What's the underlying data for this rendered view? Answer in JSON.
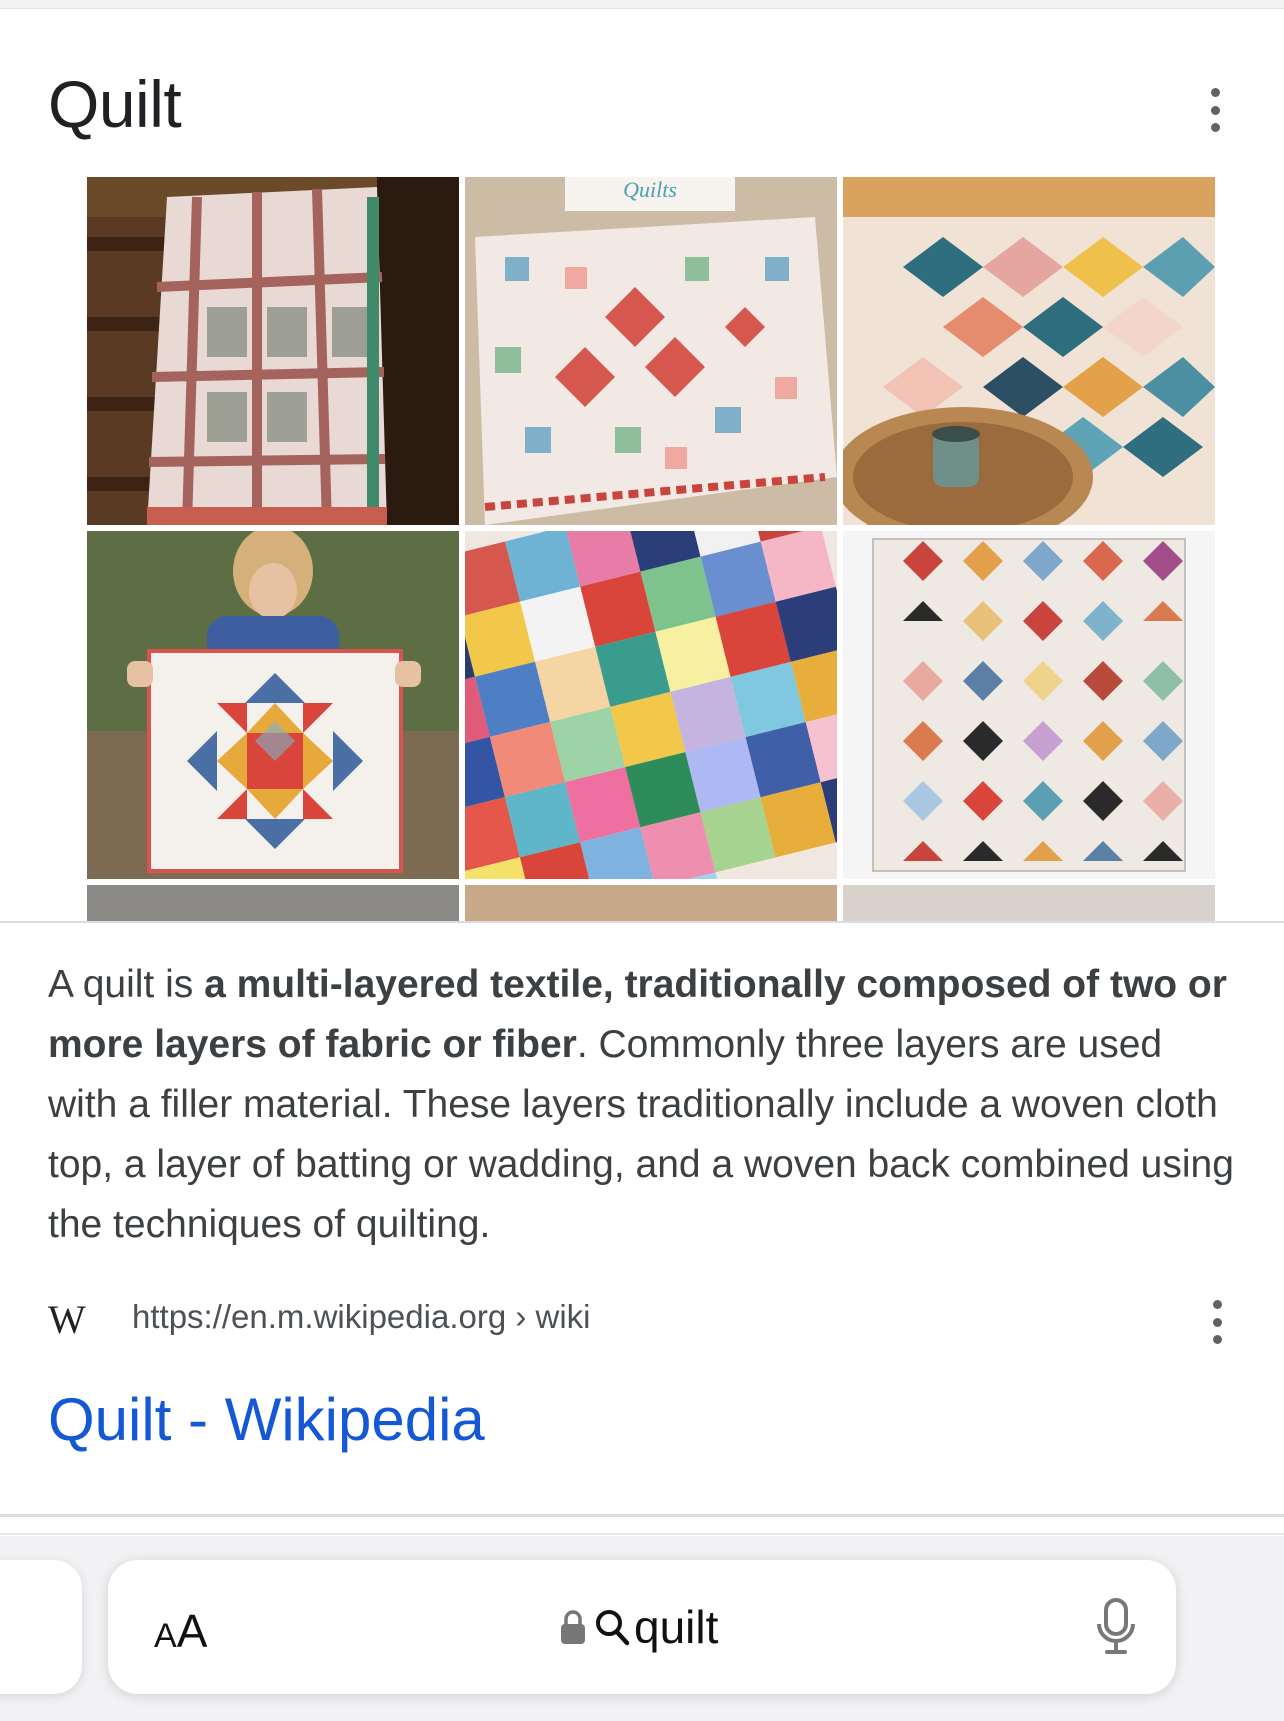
{
  "panel": {
    "title": "Quilt",
    "menu_icon": "more-vert-icon"
  },
  "image_grid": {
    "images": [
      {
        "name": "quilt-image-1",
        "description_icon": "image"
      },
      {
        "name": "quilt-image-2",
        "description_icon": "image"
      },
      {
        "name": "quilt-image-3",
        "description_icon": "image"
      },
      {
        "name": "quilt-image-4",
        "description_icon": "image"
      },
      {
        "name": "quilt-image-5",
        "description_icon": "image"
      },
      {
        "name": "quilt-image-6",
        "description_icon": "image"
      }
    ],
    "book_cover_text": "Quilts"
  },
  "description": {
    "part1": "A quilt is ",
    "bold": "a multi-layered textile, traditionally composed of two or more layers of fabric or fiber",
    "part2": ". Commonly three layers are used with a filler material. These layers traditionally include a woven cloth top, a layer of batting or wadding, and a woven back combined using the techniques of quilting."
  },
  "source": {
    "logo": "W",
    "url": "https://en.m.wikipedia.org › wiki",
    "menu_icon": "more-vert-icon"
  },
  "result": {
    "link_text": "Quilt - Wikipedia"
  },
  "browser": {
    "text_size_label_small": "A",
    "text_size_label_large": "A",
    "query": "quilt",
    "icons": [
      "lock-icon",
      "search-icon",
      "mic-icon"
    ]
  },
  "colors": {
    "link": "#1558d6",
    "text": "#3c4043",
    "divider": "#dadce0"
  }
}
